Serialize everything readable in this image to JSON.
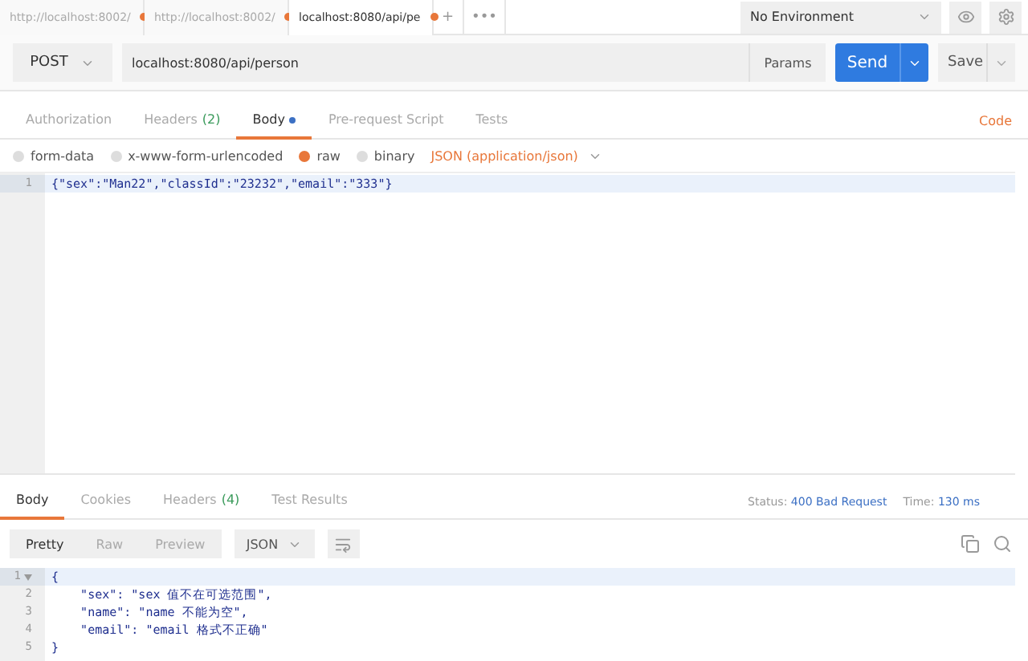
{
  "tabs": [
    {
      "label": "http://localhost:8002/",
      "selected": false,
      "unsaved": true
    },
    {
      "label": "http://localhost:8002/",
      "selected": false,
      "unsaved": true
    },
    {
      "label": "localhost:8080/api/pe",
      "selected": true,
      "unsaved": true
    }
  ],
  "tab_actions": [
    "+",
    "•••"
  ],
  "environment": {
    "value": "No Environment"
  },
  "request": {
    "method": "POST",
    "url": "localhost:8080/api/person",
    "params": "Params",
    "send": "Send",
    "save": "Save"
  },
  "request_tabs": [
    {
      "label": "Authorization",
      "selected": false,
      "dot": false
    },
    {
      "label": "Headers",
      "count": "(2)",
      "selected": false,
      "dot": false
    },
    {
      "label": "Body",
      "selected": true,
      "dot": true
    },
    {
      "label": "Pre-request Script",
      "selected": false,
      "dot": false
    },
    {
      "label": "Tests",
      "selected": false,
      "dot": false
    }
  ],
  "code_link": "Code",
  "body_types": [
    {
      "label": "form-data",
      "selected": false
    },
    {
      "label": "x-www-form-urlencoded",
      "selected": false
    },
    {
      "label": "raw",
      "selected": true
    },
    {
      "label": "binary",
      "selected": false
    }
  ],
  "content_type": "JSON (application/json)",
  "request_body": [
    {
      "number": "1",
      "text": "{\"sex\":\"Man22\",\"classId\":\"23232\",\"email\":\"333\"}"
    }
  ],
  "response_tabs": [
    {
      "label": "Body",
      "selected": true
    },
    {
      "label": "Cookies",
      "selected": false
    },
    {
      "label": "Headers",
      "count": "(4)",
      "selected": false
    },
    {
      "label": "Test Results",
      "selected": false
    }
  ],
  "status": {
    "label": "Status:",
    "value": "400 Bad Request"
  },
  "time": {
    "label": "Time:",
    "value": "130 ms"
  },
  "view_modes": [
    {
      "label": "Pretty",
      "selected": true
    },
    {
      "label": "Raw",
      "selected": false
    },
    {
      "label": "Preview",
      "selected": false
    }
  ],
  "format": "JSON",
  "response_body": [
    {
      "number": "1",
      "text": "{",
      "foldable": true
    },
    {
      "number": "2",
      "text": "    \"sex\": \"sex 值不在可选范围\",",
      "foldable": false
    },
    {
      "number": "3",
      "text": "    \"name\": \"name 不能为空\",",
      "foldable": false
    },
    {
      "number": "4",
      "text": "    \"email\": \"email 格式不正确\"",
      "foldable": false
    },
    {
      "number": "5",
      "text": "}",
      "foldable": false
    }
  ]
}
